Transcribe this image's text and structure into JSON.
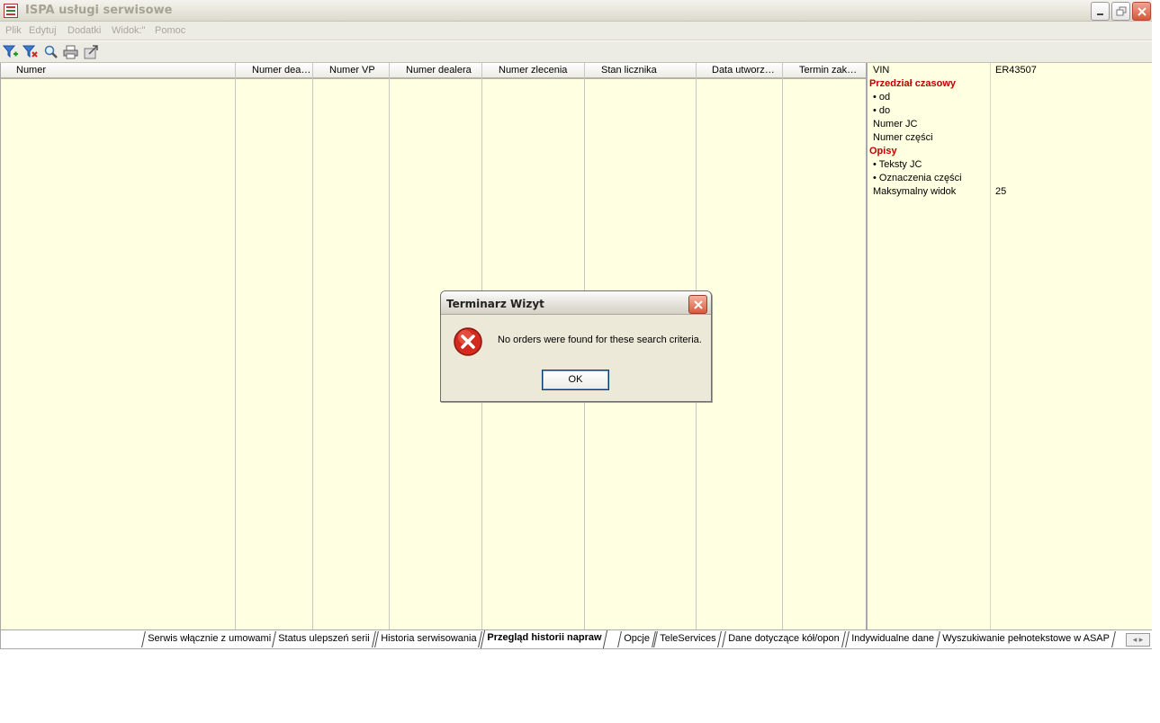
{
  "window": {
    "title": "ISPA usługi serwisowe",
    "controls": [
      "minimize-icon",
      "restore-icon",
      "close-icon"
    ]
  },
  "menu": {
    "items": [
      "Plik",
      "Edytuj",
      "Dodatki",
      "Widok:\"",
      "Pomoc"
    ]
  },
  "toolbar": {
    "icons": [
      "filter-add-icon",
      "filter-remove-icon",
      "search-icon",
      "print-icon",
      "export-icon"
    ]
  },
  "grid": {
    "columns": [
      "Numer",
      "Numer dea…",
      "Numer VP",
      "Numer dealera",
      "Numer zlecenia",
      "Stan licznika",
      "Data utworz…",
      "Termin zak…"
    ],
    "rows": []
  },
  "properties": {
    "vin_label": "VIN",
    "vin_value": "ER43507",
    "section_time": "Przedział czasowy",
    "from_label": "• od",
    "to_label": "• do",
    "jc_label": "Numer JC",
    "part_label": "Numer części",
    "section_desc": "Opisy",
    "jc_texts_label": "• Teksty JC",
    "part_marks_label": "• Oznaczenia części",
    "max_view_label": "Maksymalny widok",
    "max_view_value": "25",
    "section_color": "#c00000"
  },
  "tabs": {
    "items": [
      "Serwis włącznie z umowami",
      "Status ulepszeń serii",
      "Historia serwisowania",
      "Przegląd historii napraw",
      "Opcje",
      "TeleServices",
      "Dane dotyczące kół/opon",
      "Indywidualne dane",
      "Wyszukiwanie pełnotekstowe w ASAP"
    ],
    "active": "Przegląd historii napraw"
  },
  "dialog": {
    "title": "Terminarz Wizyt",
    "message": "No orders were found for these search criteria.",
    "ok_label": "OK",
    "icon": "error-icon"
  }
}
